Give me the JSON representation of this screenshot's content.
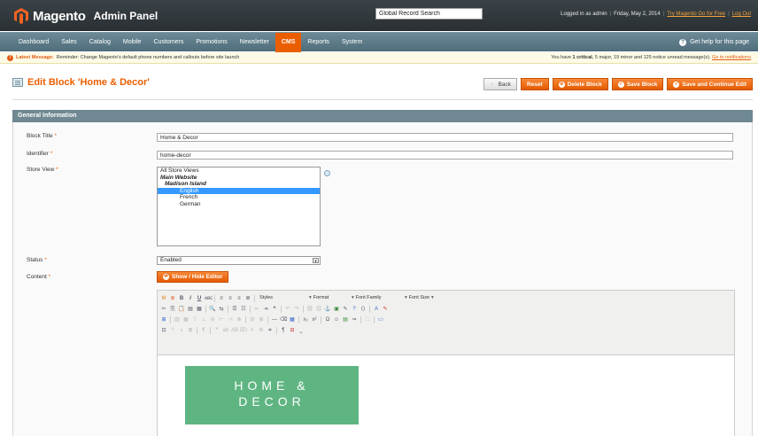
{
  "header": {
    "logo_text": "Magento",
    "logo_sub": "Admin Panel",
    "search_value": "Global Record Search",
    "logged_in": "Logged in as admin",
    "date": "Friday, May 2, 2014",
    "try_link": "Try Magento Go for Free",
    "logout": "Log Out"
  },
  "nav": {
    "items": [
      "Dashboard",
      "Sales",
      "Catalog",
      "Mobile",
      "Customers",
      "Promotions",
      "Newsletter",
      "CMS",
      "Reports",
      "System"
    ],
    "help": "Get help for this page"
  },
  "message": {
    "latest_label": "Latest Message:",
    "text": "Reminder: Change Magento's default phone numbers and callouts before site launch",
    "right_prefix": "You have",
    "critical_count": "1",
    "critical_label": "critical",
    "rest": ", 5 major, 19 minor and 125 notice unread message(s).",
    "link": "Go to notifications"
  },
  "page": {
    "title": "Edit Block 'Home & Decor'",
    "buttons": {
      "back": "Back",
      "reset": "Reset",
      "delete": "Delete Block",
      "save": "Save Block",
      "save_continue": "Save and Continue Edit"
    }
  },
  "section": {
    "title": "General Information"
  },
  "form": {
    "block_title_label": "Block Title",
    "block_title_value": "Home & Decor",
    "identifier_label": "Identifier",
    "identifier_value": "home-decor",
    "store_view_label": "Store View",
    "store_views": [
      "All Store Views",
      "Main Website",
      "Madison Island",
      "English",
      "French",
      "German"
    ],
    "status_label": "Status",
    "status_value": "Enabled",
    "content_label": "Content",
    "show_hide_editor": "Show / Hide Editor",
    "required_mark": "*"
  },
  "editor": {
    "styles": "Styles",
    "format": "Format",
    "font_family": "Font Family",
    "font_size": "Font Size",
    "content_line1": "HOME &",
    "content_line2": "DECOR"
  },
  "colors": {
    "accent": "#eb5e00",
    "nav": "#5b7a88",
    "banner": "#5fb582",
    "selected": "#3399ff"
  }
}
